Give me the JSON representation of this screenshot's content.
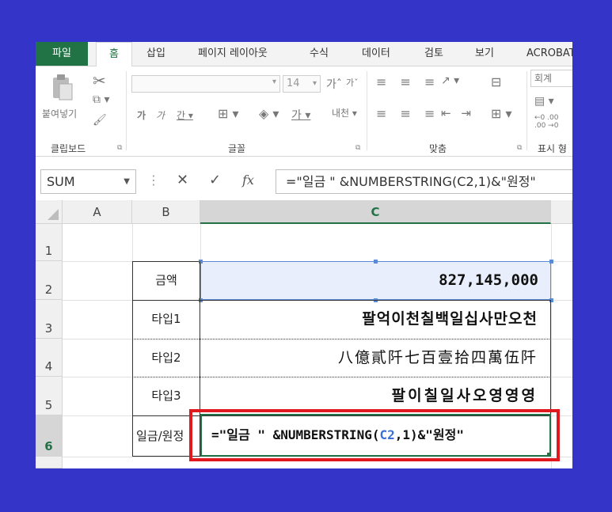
{
  "ribbon_tabs": [
    "파일",
    "홈",
    "삽입",
    "페이지 레이아웃",
    "수식",
    "데이터",
    "검토",
    "보기",
    "ACROBAT"
  ],
  "ribbon": {
    "paste_label": "붙여넣기",
    "font_size": "14",
    "number_format": "회계",
    "groups": {
      "clipboard": "클립보드",
      "font": "글꼴",
      "alignment": "맞춤",
      "number": "표시 형"
    }
  },
  "formula_bar": {
    "name_box": "SUM",
    "formula": "=\"일금 \" &NUMBERSTRING(C2,1)&\"원정\""
  },
  "grid": {
    "columns": [
      "A",
      "B",
      "C"
    ],
    "rows": [
      "1",
      "2",
      "3",
      "4",
      "5",
      "6"
    ],
    "cells": {
      "B2": "금액",
      "C2": "827,145,000",
      "B3": "타입1",
      "C3": "팔억이천칠백일십사만오천",
      "B4": "타입2",
      "C4": "八億貳阡七百壹拾四萬伍阡",
      "B5": "타입3",
      "C5": "팔이칠일사오영영영",
      "B6": "일금/원정",
      "C6_prefix": "=\"일금 \" &NUMBERSTRING(",
      "C6_ref": "C2",
      "C6_suffix": ",1)&\"원정\""
    }
  },
  "colors": {
    "background": "#3434c8",
    "excel_green": "#217346",
    "highlight_red": "#e0191f",
    "reference_blue": "#3a6fd8"
  }
}
